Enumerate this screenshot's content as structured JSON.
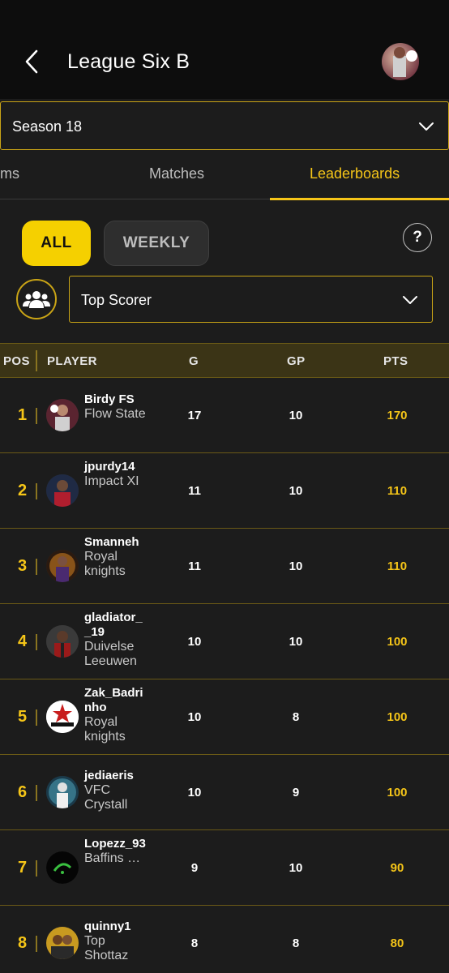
{
  "header": {
    "title": "League Six B"
  },
  "season_select": {
    "value": "Season 18"
  },
  "tabs": [
    {
      "label": "ams"
    },
    {
      "label": "Matches"
    },
    {
      "label": "Leaderboards"
    }
  ],
  "filters": {
    "all_label": "ALL",
    "weekly_label": "WEEKLY",
    "help_label": "?",
    "stat_select": "Top Scorer"
  },
  "table": {
    "headers": {
      "pos": "POS",
      "player": "PLAYER",
      "g": "G",
      "gp": "GP",
      "pts": "PTS"
    },
    "rows": [
      {
        "pos": "1",
        "player": "Birdy FS",
        "team": "Flow State",
        "g": "17",
        "gp": "10",
        "pts": "170"
      },
      {
        "pos": "2",
        "player": "jpurdy14",
        "team": "Impact XI",
        "g": "11",
        "gp": "10",
        "pts": "110"
      },
      {
        "pos": "3",
        "player": "Smanneh",
        "team": "Royal knights",
        "g": "11",
        "gp": "10",
        "pts": "110"
      },
      {
        "pos": "4",
        "player": "gladiator__19",
        "team": "Duivelse Leeuwen",
        "g": "10",
        "gp": "10",
        "pts": "100"
      },
      {
        "pos": "5",
        "player": "Zak_Badrinho",
        "team": "Royal knights",
        "g": "10",
        "gp": "8",
        "pts": "100"
      },
      {
        "pos": "6",
        "player": "jediaeris",
        "team": "VFC Crystall",
        "g": "10",
        "gp": "9",
        "pts": "100"
      },
      {
        "pos": "7",
        "player": "Lopezz_93",
        "team": "Baffins Rovers…",
        "g": "9",
        "gp": "10",
        "pts": "90"
      },
      {
        "pos": "8",
        "player": "quinny1",
        "team": "Top Shottaz",
        "g": "8",
        "gp": "8",
        "pts": "80"
      }
    ]
  },
  "colors": {
    "accent": "#f5c518",
    "gold_border": "#c9a416",
    "background": "#1c1c1c",
    "header_bg": "#0d0d0d"
  }
}
